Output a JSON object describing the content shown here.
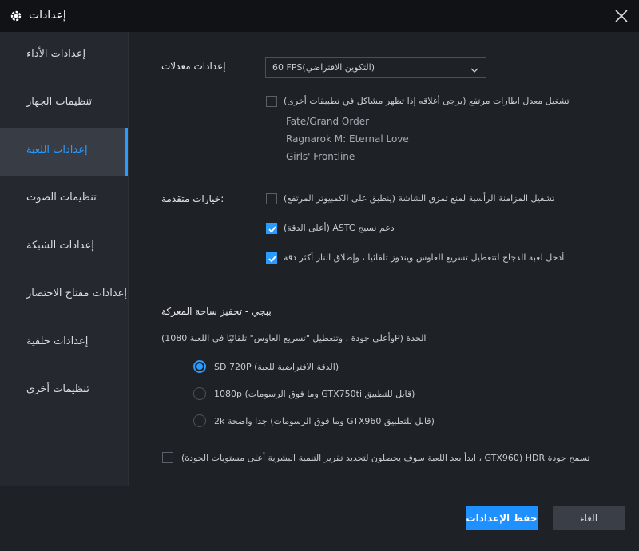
{
  "window": {
    "title": "إعدادات",
    "icons": {
      "logo": "gear-icon",
      "close": "close-icon"
    }
  },
  "sidebar": {
    "items": [
      {
        "label": "إعدادات الأداء"
      },
      {
        "label": "تنظيمات الجهاز"
      },
      {
        "label": "إعدادات اللعبة"
      },
      {
        "label": "تنظيمات الصوت"
      },
      {
        "label": "إعدادات الشبكة"
      },
      {
        "label": "إعدادات مفتاح الاختصار"
      },
      {
        "label": "إعدادات خلفية"
      },
      {
        "label": "تنظيمات أخرى"
      }
    ],
    "active_index": 2
  },
  "frame_rate": {
    "label": "إعدادات معدلات",
    "dropdown_value": "60 FPS(التكوين الافتراضي)",
    "high_fps": {
      "label": "(يرجى أغلاقه إذا تظهر مشاكل في تطبيقات أخرى)   تشغيل معدل اطارات مرتفع",
      "checked": false
    },
    "games": [
      "Fate/Grand Order",
      "Ragnarok M: Eternal Love",
      "Girls' Frontline"
    ]
  },
  "advanced": {
    "label": "خيارات متقدمة:",
    "options": [
      {
        "label": "(ينطبق على الكمبيوتر المرتفع)   تشغيل المزامنة الرأسية لمنع تمزق الشاشة",
        "checked": false
      },
      {
        "label": "(أعلى الدقة)   ASTC دعم نسيج",
        "checked": true
      },
      {
        "label": "أدخل لعبة الدجاج لتتعطيل تسريع العاوس ويندوز تلقائيا ، وإطلاق النار أكثر دقة",
        "checked": true
      }
    ]
  },
  "pubg": {
    "title": "ببجي - تحفيز ساحة المعركة",
    "note": "(وأعلى جودة ، وتتعطيل \"تسريع العاوس\" تلقائيًا في اللعبة 1080P)   الحدة",
    "options": [
      {
        "label": "SD 720P   (الدقة الافتراضية للعبة)",
        "checked": true
      },
      {
        "label": "1080p   (وما فوق الرسومات GTX750ti قابل للتطبيق)",
        "checked": false
      },
      {
        "label": "2k   جدا واضحة (وما فوق الرسومات GTX960 قابل للتطبيق)",
        "checked": false
      }
    ],
    "hdr": {
      "label": "(ابدأ بعد اللعبة سوف يحصلون لتحديد تقرير التنمية البشرية أعلى مستويات الجودة ، GTX960)   HDR تسمح جودة",
      "checked": false
    }
  },
  "footer": {
    "save_label": "حفظ الإعدادات",
    "cancel_label": "الغاء"
  },
  "colors": {
    "accent": "#1e90ff",
    "background": "#1e2126",
    "sidebar": "#25282e",
    "titlebar": "#101216"
  }
}
